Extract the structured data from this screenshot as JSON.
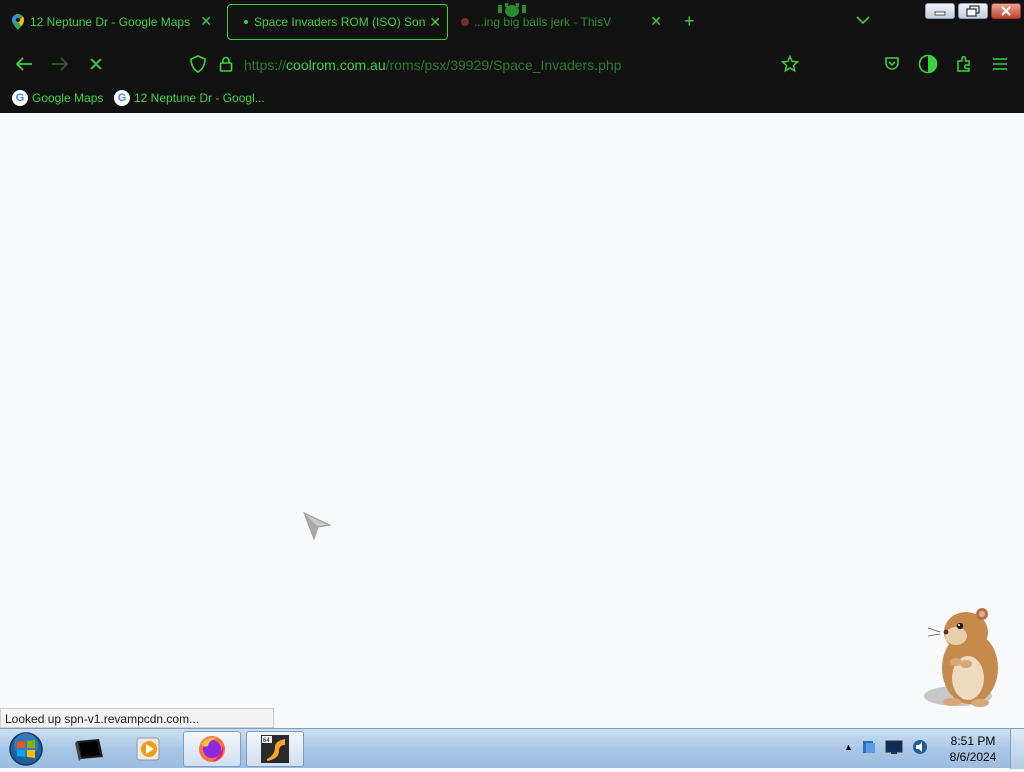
{
  "browser": {
    "tabs": [
      {
        "title": "12 Neptune Dr - Google Maps",
        "icon": "map-pin-icon"
      },
      {
        "title": "Space Invaders ROM (ISO) Sony",
        "icon": "loading-dot-icon"
      },
      {
        "title": "...ing big balls jerk - ThisV",
        "icon": "favicon-icon"
      }
    ],
    "address": {
      "prefix": "https://",
      "host": "coolrom.com.au",
      "path": "/roms/psx/39929/Space_Invaders.php"
    },
    "bookmarks": [
      {
        "label": "Google Maps",
        "icon": "google-icon"
      },
      {
        "label": "12 Neptune Dr - Googl...",
        "icon": "google-icon"
      }
    ],
    "status_text": "Looked up spn-v1.revampcdn.com..."
  },
  "taskbar": {
    "clock_time": "8:51 PM",
    "clock_date": "8/6/2024"
  },
  "colors": {
    "accent": "#3cd23c",
    "chrome_bg": "#111111",
    "page_bg": "#f8f9fa"
  }
}
